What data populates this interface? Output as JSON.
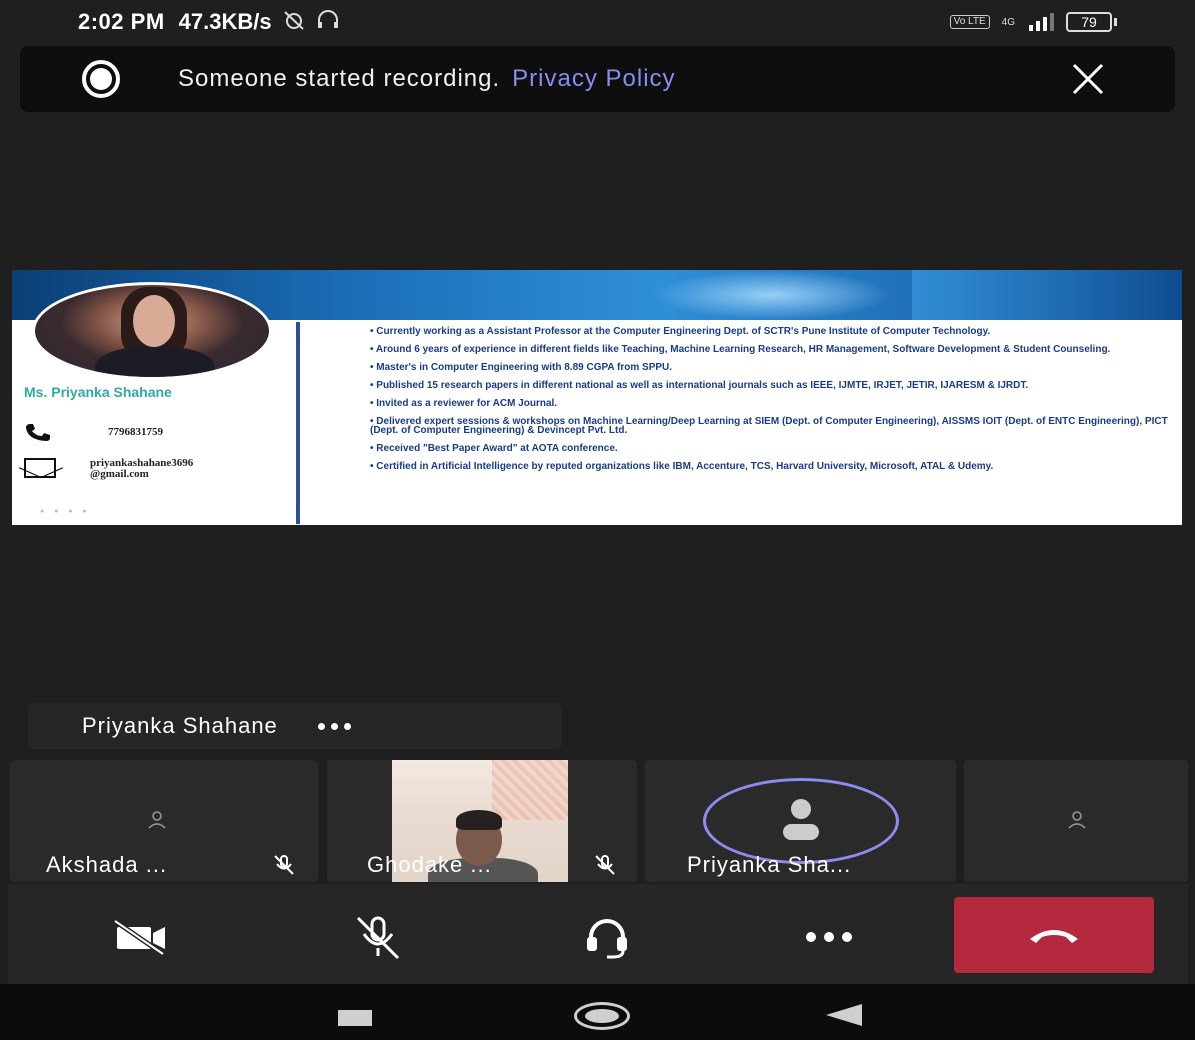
{
  "status_bar": {
    "time": "2:02 PM",
    "network_speed": "47.3KB/s",
    "network_type": "4G",
    "volte_label": "Vo LTE",
    "battery": "79"
  },
  "banner": {
    "message": "Someone started recording.",
    "link_text": "Privacy Policy",
    "link_color": "#8a8df0"
  },
  "shared_screen": {
    "name": "Ms. Priyanka Shahane",
    "phone": "7796831759",
    "email_line1": "priyankashahane3696",
    "email_line2": "@gmail.com",
    "bullets": [
      "• Currently working as a Assistant Professor at the  Computer Engineering Dept. of SCTR's Pune Institute of Computer Technology.",
      "• Around 6 years of experience in different fields like Teaching, Machine Learning Research, HR Management, Software Development & Student Counseling.",
      "• Master's in Computer Engineering with 8.89 CGPA from SPPU.",
      "• Published 15 research papers in different national as well as international journals such as IEEE, IJMTE, IRJET, JETIR, IJARESM & IJRDT.",
      "• Invited as a reviewer for ACM Journal.",
      "• Delivered expert sessions & workshops on Machine Learning/Deep Learning at SIEM (Dept. of Computer Engineering), AISSMS IOIT (Dept. of ENTC Engineering), PICT (Dept. of Computer Engineering) & Devincept Pvt. Ltd.",
      "• Received \"Best Paper Award\" at AOTA conference.",
      "• Certified in Artificial Intelligence by reputed organizations like IBM, Accenture, TCS, Harvard University, Microsoft, ATAL & Udemy."
    ]
  },
  "active_speaker": {
    "name": "Priyanka Shahane"
  },
  "participants": [
    {
      "name": "Akshada ...",
      "muted": true
    },
    {
      "name": "Ghodake ...",
      "muted": true
    },
    {
      "name": "Priyanka Sha...",
      "muted": false
    },
    {
      "name": "",
      "muted": false
    }
  ],
  "colors": {
    "hangup": "#b4293e",
    "speaking_ring": "#8c8cf0",
    "name_teal": "#31a9a0",
    "bullet_text": "#1a3c86"
  }
}
